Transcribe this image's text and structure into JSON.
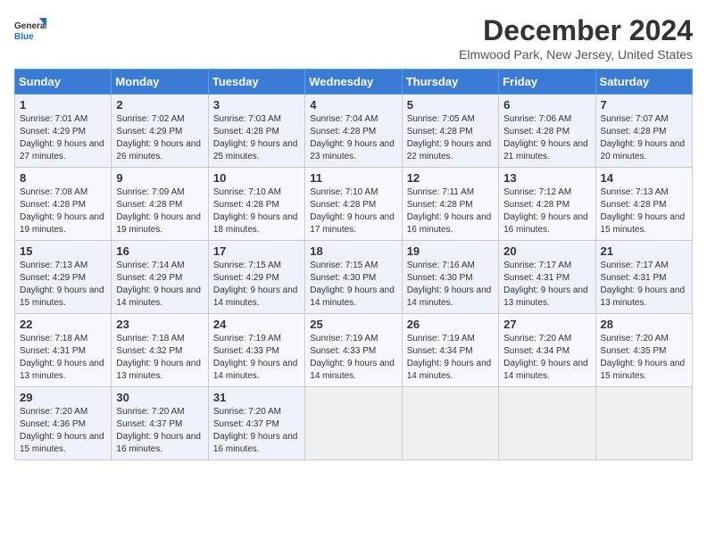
{
  "header": {
    "logo_general": "General",
    "logo_blue": "Blue",
    "month_title": "December 2024",
    "location": "Elmwood Park, New Jersey, United States"
  },
  "weekdays": [
    "Sunday",
    "Monday",
    "Tuesday",
    "Wednesday",
    "Thursday",
    "Friday",
    "Saturday"
  ],
  "weeks": [
    [
      {
        "day": "1",
        "sunrise": "Sunrise: 7:01 AM",
        "sunset": "Sunset: 4:29 PM",
        "daylight": "Daylight: 9 hours and 27 minutes."
      },
      {
        "day": "2",
        "sunrise": "Sunrise: 7:02 AM",
        "sunset": "Sunset: 4:29 PM",
        "daylight": "Daylight: 9 hours and 26 minutes."
      },
      {
        "day": "3",
        "sunrise": "Sunrise: 7:03 AM",
        "sunset": "Sunset: 4:28 PM",
        "daylight": "Daylight: 9 hours and 25 minutes."
      },
      {
        "day": "4",
        "sunrise": "Sunrise: 7:04 AM",
        "sunset": "Sunset: 4:28 PM",
        "daylight": "Daylight: 9 hours and 23 minutes."
      },
      {
        "day": "5",
        "sunrise": "Sunrise: 7:05 AM",
        "sunset": "Sunset: 4:28 PM",
        "daylight": "Daylight: 9 hours and 22 minutes."
      },
      {
        "day": "6",
        "sunrise": "Sunrise: 7:06 AM",
        "sunset": "Sunset: 4:28 PM",
        "daylight": "Daylight: 9 hours and 21 minutes."
      },
      {
        "day": "7",
        "sunrise": "Sunrise: 7:07 AM",
        "sunset": "Sunset: 4:28 PM",
        "daylight": "Daylight: 9 hours and 20 minutes."
      }
    ],
    [
      {
        "day": "8",
        "sunrise": "Sunrise: 7:08 AM",
        "sunset": "Sunset: 4:28 PM",
        "daylight": "Daylight: 9 hours and 19 minutes."
      },
      {
        "day": "9",
        "sunrise": "Sunrise: 7:09 AM",
        "sunset": "Sunset: 4:28 PM",
        "daylight": "Daylight: 9 hours and 19 minutes."
      },
      {
        "day": "10",
        "sunrise": "Sunrise: 7:10 AM",
        "sunset": "Sunset: 4:28 PM",
        "daylight": "Daylight: 9 hours and 18 minutes."
      },
      {
        "day": "11",
        "sunrise": "Sunrise: 7:10 AM",
        "sunset": "Sunset: 4:28 PM",
        "daylight": "Daylight: 9 hours and 17 minutes."
      },
      {
        "day": "12",
        "sunrise": "Sunrise: 7:11 AM",
        "sunset": "Sunset: 4:28 PM",
        "daylight": "Daylight: 9 hours and 16 minutes."
      },
      {
        "day": "13",
        "sunrise": "Sunrise: 7:12 AM",
        "sunset": "Sunset: 4:28 PM",
        "daylight": "Daylight: 9 hours and 16 minutes."
      },
      {
        "day": "14",
        "sunrise": "Sunrise: 7:13 AM",
        "sunset": "Sunset: 4:28 PM",
        "daylight": "Daylight: 9 hours and 15 minutes."
      }
    ],
    [
      {
        "day": "15",
        "sunrise": "Sunrise: 7:13 AM",
        "sunset": "Sunset: 4:29 PM",
        "daylight": "Daylight: 9 hours and 15 minutes."
      },
      {
        "day": "16",
        "sunrise": "Sunrise: 7:14 AM",
        "sunset": "Sunset: 4:29 PM",
        "daylight": "Daylight: 9 hours and 14 minutes."
      },
      {
        "day": "17",
        "sunrise": "Sunrise: 7:15 AM",
        "sunset": "Sunset: 4:29 PM",
        "daylight": "Daylight: 9 hours and 14 minutes."
      },
      {
        "day": "18",
        "sunrise": "Sunrise: 7:15 AM",
        "sunset": "Sunset: 4:30 PM",
        "daylight": "Daylight: 9 hours and 14 minutes."
      },
      {
        "day": "19",
        "sunrise": "Sunrise: 7:16 AM",
        "sunset": "Sunset: 4:30 PM",
        "daylight": "Daylight: 9 hours and 14 minutes."
      },
      {
        "day": "20",
        "sunrise": "Sunrise: 7:17 AM",
        "sunset": "Sunset: 4:31 PM",
        "daylight": "Daylight: 9 hours and 13 minutes."
      },
      {
        "day": "21",
        "sunrise": "Sunrise: 7:17 AM",
        "sunset": "Sunset: 4:31 PM",
        "daylight": "Daylight: 9 hours and 13 minutes."
      }
    ],
    [
      {
        "day": "22",
        "sunrise": "Sunrise: 7:18 AM",
        "sunset": "Sunset: 4:31 PM",
        "daylight": "Daylight: 9 hours and 13 minutes."
      },
      {
        "day": "23",
        "sunrise": "Sunrise: 7:18 AM",
        "sunset": "Sunset: 4:32 PM",
        "daylight": "Daylight: 9 hours and 13 minutes."
      },
      {
        "day": "24",
        "sunrise": "Sunrise: 7:19 AM",
        "sunset": "Sunset: 4:33 PM",
        "daylight": "Daylight: 9 hours and 14 minutes."
      },
      {
        "day": "25",
        "sunrise": "Sunrise: 7:19 AM",
        "sunset": "Sunset: 4:33 PM",
        "daylight": "Daylight: 9 hours and 14 minutes."
      },
      {
        "day": "26",
        "sunrise": "Sunrise: 7:19 AM",
        "sunset": "Sunset: 4:34 PM",
        "daylight": "Daylight: 9 hours and 14 minutes."
      },
      {
        "day": "27",
        "sunrise": "Sunrise: 7:20 AM",
        "sunset": "Sunset: 4:34 PM",
        "daylight": "Daylight: 9 hours and 14 minutes."
      },
      {
        "day": "28",
        "sunrise": "Sunrise: 7:20 AM",
        "sunset": "Sunset: 4:35 PM",
        "daylight": "Daylight: 9 hours and 15 minutes."
      }
    ],
    [
      {
        "day": "29",
        "sunrise": "Sunrise: 7:20 AM",
        "sunset": "Sunset: 4:36 PM",
        "daylight": "Daylight: 9 hours and 15 minutes."
      },
      {
        "day": "30",
        "sunrise": "Sunrise: 7:20 AM",
        "sunset": "Sunset: 4:37 PM",
        "daylight": "Daylight: 9 hours and 16 minutes."
      },
      {
        "day": "31",
        "sunrise": "Sunrise: 7:20 AM",
        "sunset": "Sunset: 4:37 PM",
        "daylight": "Daylight: 9 hours and 16 minutes."
      },
      null,
      null,
      null,
      null
    ]
  ]
}
